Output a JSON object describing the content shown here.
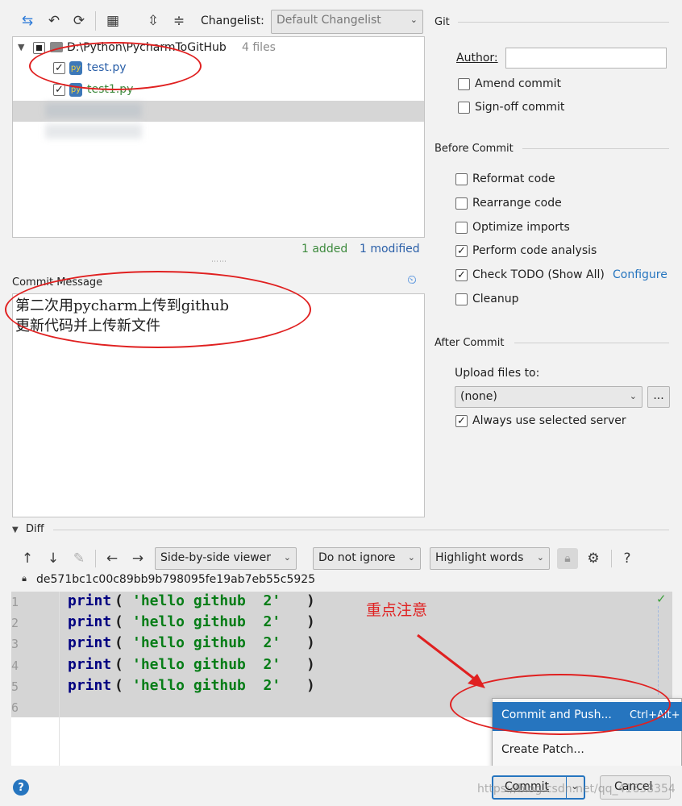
{
  "toolbar": {
    "changelist_label": "Changelist:",
    "changelist_value": "Default Changelist"
  },
  "tree": {
    "root_path": "D:\\Python\\PycharmToGitHub",
    "root_count": "4 files",
    "files": [
      {
        "name": "test.py",
        "checked": true
      },
      {
        "name": "test1.py",
        "checked": true
      }
    ],
    "stats_added": "1 added",
    "stats_modified": "1 modified"
  },
  "commit_message": {
    "title": "Commit Message",
    "line1": "第二次用pycharm上传到github",
    "line2": "更新代码并上传新文件"
  },
  "git": {
    "section": "Git",
    "author_label": "Author:",
    "author_value": "",
    "amend": "Amend commit",
    "signoff": "Sign-off commit"
  },
  "before_commit": {
    "section": "Before Commit",
    "reformat": "Reformat code",
    "rearrange": "Rearrange code",
    "optimize": "Optimize imports",
    "analysis": "Perform code analysis",
    "todo": "Check TODO (Show All)",
    "configure": "Configure",
    "cleanup": "Cleanup"
  },
  "after_commit": {
    "section": "After Commit",
    "upload_label": "Upload files to:",
    "upload_value": "(none)",
    "browse": "...",
    "always_use": "Always use selected server"
  },
  "diff": {
    "title": "Diff",
    "viewer": "Side-by-side viewer",
    "ignore": "Do not ignore",
    "highlight": "Highlight words",
    "help": "?",
    "hash": "de571bc1c00c89bb9b798095fe19ab7eb55c5925",
    "lines": [
      {
        "num": "1",
        "kw": "print",
        "str": "'hello github  2'"
      },
      {
        "num": "2",
        "kw": "print",
        "str": "'hello github  2'"
      },
      {
        "num": "3",
        "kw": "print",
        "str": "'hello github  2'"
      },
      {
        "num": "4",
        "kw": "print",
        "str": "'hello github  2'"
      },
      {
        "num": "5",
        "kw": "print",
        "str": "'hello github  2'"
      },
      {
        "num": "6",
        "kw": "",
        "str": ""
      }
    ]
  },
  "annotation": "重点注意",
  "popup": {
    "commit_push": "Commit and Push...",
    "shortcut": "Ctrl+Alt+",
    "create_patch": "Create Patch..."
  },
  "buttons": {
    "commit": "Commit",
    "cancel": "Cancel",
    "help": "?"
  },
  "watermark": "https://blog.csdn.net/qq_41638354",
  "colors": {
    "accent": "#2675bf",
    "added_green": "#3d8a3d",
    "modified_blue": "#2a5fa8",
    "keyword": "#000080",
    "string": "#067d17",
    "annotation_red": "#e02020"
  }
}
